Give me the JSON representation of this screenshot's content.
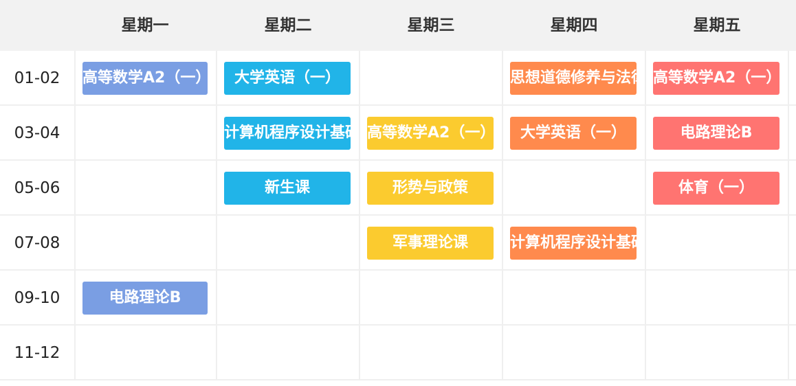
{
  "days": [
    "星期一",
    "星期二",
    "星期三",
    "星期四",
    "星期五"
  ],
  "periods": [
    "01-02",
    "03-04",
    "05-06",
    "07-08",
    "09-10",
    "11-12"
  ],
  "courses": [
    {
      "day": 0,
      "period": 0,
      "name": "高等数学A2（一）",
      "color": "#7a9ee3"
    },
    {
      "day": 0,
      "period": 4,
      "name": "电路理论B",
      "color": "#7a9ee3"
    },
    {
      "day": 1,
      "period": 0,
      "name": "大学英语（一）",
      "color": "#21b4e8"
    },
    {
      "day": 1,
      "period": 1,
      "name": "计算机程序设计基础",
      "color": "#21b4e8"
    },
    {
      "day": 1,
      "period": 2,
      "name": "新生课",
      "color": "#21b4e8"
    },
    {
      "day": 2,
      "period": 1,
      "name": "高等数学A2（一）",
      "color": "#fbcb2f"
    },
    {
      "day": 2,
      "period": 2,
      "name": "形势与政策",
      "color": "#fbcb2f"
    },
    {
      "day": 2,
      "period": 3,
      "name": "军事理论课",
      "color": "#fbcb2f"
    },
    {
      "day": 3,
      "period": 0,
      "name": "思想道德修养与法律基础",
      "color": "#ff8a4d"
    },
    {
      "day": 3,
      "period": 1,
      "name": "大学英语（一）",
      "color": "#ff8a4d"
    },
    {
      "day": 3,
      "period": 3,
      "name": "计算机程序设计基础",
      "color": "#ff8a4d"
    },
    {
      "day": 4,
      "period": 0,
      "name": "高等数学A2（一）",
      "color": "#ff7471"
    },
    {
      "day": 4,
      "period": 1,
      "name": "电路理论B",
      "color": "#ff7471"
    },
    {
      "day": 4,
      "period": 2,
      "name": "体育（一）",
      "color": "#ff7471"
    }
  ]
}
